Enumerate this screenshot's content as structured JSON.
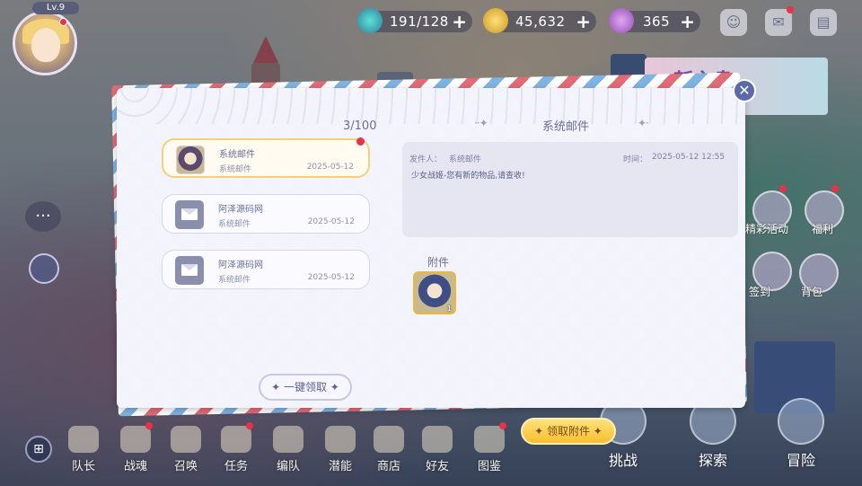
{
  "hud": {
    "level": "Lv.9",
    "stamina": "191/128",
    "gold": "45,632",
    "gems": "365",
    "plus": "+"
  },
  "banner": {
    "text": "新主盘"
  },
  "side": {
    "event_label": "精彩活动",
    "welfare_label": "福利",
    "sign_label": "签到",
    "bag_label": "背包"
  },
  "bottom_nav": {
    "items": [
      "队长",
      "战魂",
      "召唤",
      "任务",
      "编队",
      "潜能",
      "商店",
      "好友",
      "图鉴"
    ],
    "challenge": "挑战",
    "explore": "探索",
    "adventure": "冒险"
  },
  "mail": {
    "count": "3/100",
    "title": "系统邮件",
    "title_deco_left": "··✦",
    "title_deco_right": "✦·",
    "close_icon": "✕",
    "list": [
      {
        "title": "系统邮件",
        "subtitle": "系统邮件",
        "date": "2025-05-12",
        "icon": "portrait-icon"
      },
      {
        "title": "阿泽源码网",
        "subtitle": "系统邮件",
        "date": "2025-05-12",
        "icon": "envelope-icon"
      },
      {
        "title": "阿泽源码网",
        "subtitle": "系统邮件",
        "date": "2025-05-12",
        "icon": "envelope-icon"
      }
    ],
    "detail": {
      "sender_label": "发件人：",
      "sender": "系统邮件",
      "time_label": "时间：",
      "time": "2025-05-12 12:55",
      "body": "少女战姬-您有新的物品,请查收!"
    },
    "attachment_label": "附件",
    "attachment_count": "1",
    "claim_all_label": "✦ 一键领取 ✦",
    "claim_attachment_label": "✦ 领取附件 ✦"
  },
  "colors": {
    "accent": "#6a6f95",
    "badge": "#e8314a",
    "gold_button": "#f7be2f"
  }
}
